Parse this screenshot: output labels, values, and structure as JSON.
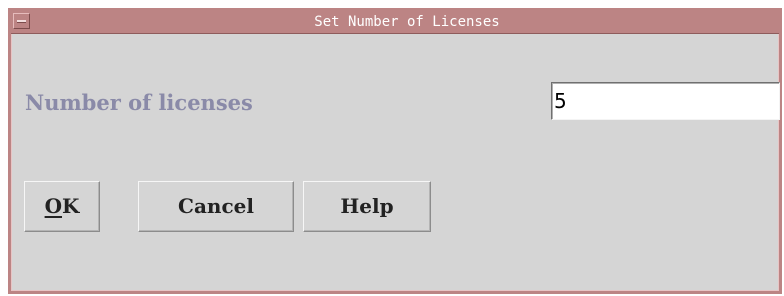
{
  "window": {
    "title": "Set Number of Licenses",
    "accent_color": "#bc8484",
    "system_menu_icon": "window-menu-icon"
  },
  "form": {
    "field_label": "Number of licenses",
    "field_value": "5"
  },
  "buttons": {
    "ok_mnemonic": "O",
    "ok_rest": "K",
    "cancel_label": "Cancel",
    "help_label": "Help"
  }
}
